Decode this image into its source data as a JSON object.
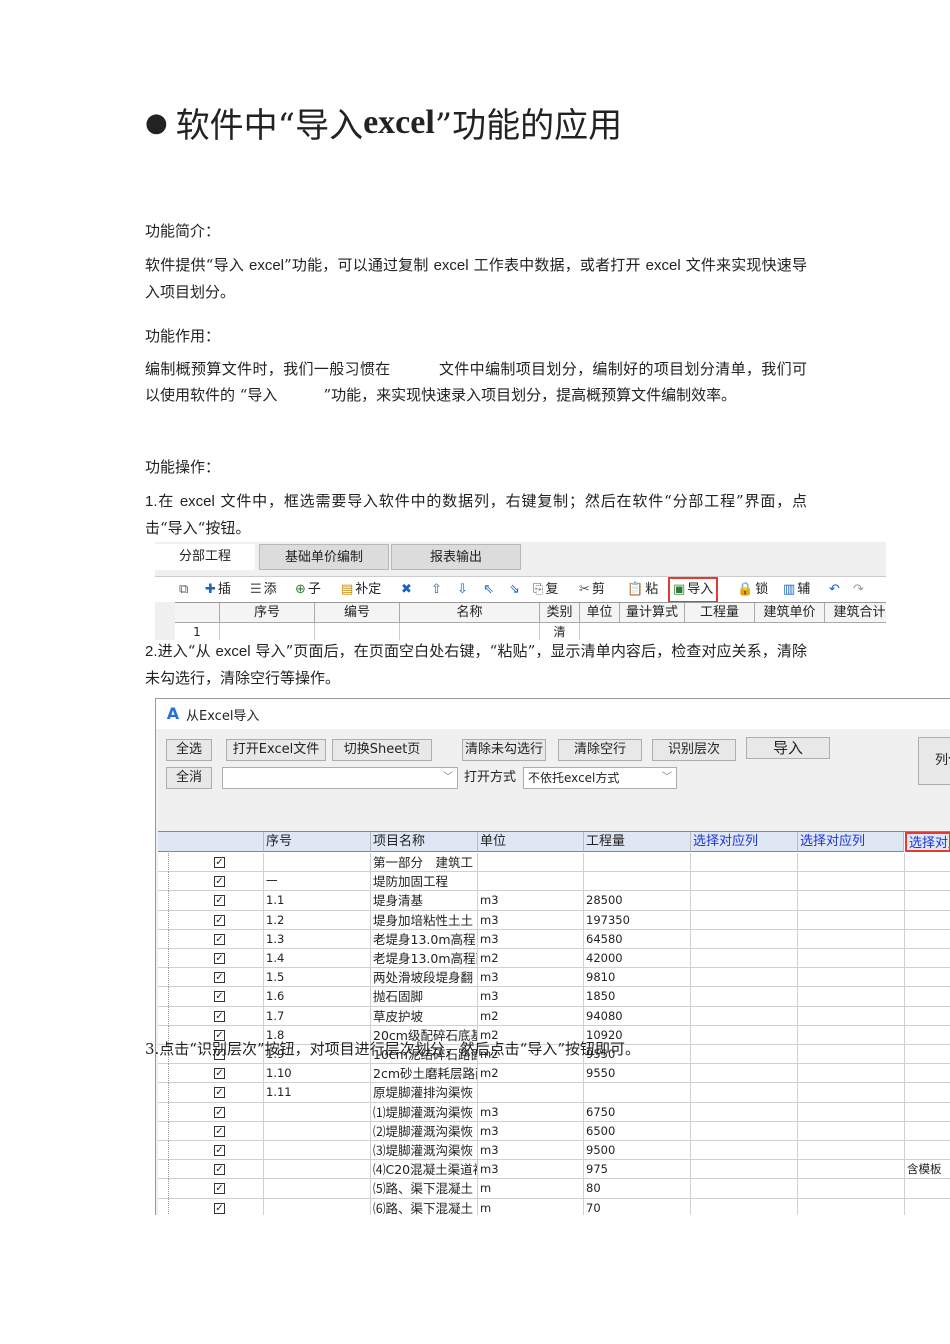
{
  "heading": {
    "bullet": "●",
    "pre": "软件中“导入 ",
    "en": "excel",
    "post": "”功能的应用"
  },
  "sections": {
    "intro_label": "功能简介：",
    "intro_a": "软件提供“导入 ",
    "intro_b": "excel",
    "intro_c": "”功能，可以通过复制 ",
    "intro_d": "excel",
    "intro_e": " 工作表中数据，或者打开 ",
    "intro_f": "excel",
    "intro_g": " 文件来实现快速导入项目划分。",
    "role_label": "功能作用：",
    "role_a": "编制概预算文件时，我们一般习惯在",
    "role_b": "文件中编制项目划分，编制好的项目划分清单，我们可以使用软件的 “导入",
    "role_c": "”功能，来实现快速录入项目划分，提高概预算文件编制效率。",
    "ops_label": "功能操作：",
    "step1_a": "1.",
    "step1_b": "在 ",
    "step1_c": "excel",
    "step1_d": " 文件中，框选需要导入软件中的数据列，右键复制；然后在软件“分部工程”界面，点击“导入“按钮。",
    "step2_a": "2.",
    "step2_b": "进入“从 ",
    "step2_c": "excel",
    "step2_d": " 导入”页面后，在页面空白处右键，“粘贴”，显示清单内容后，检查对应关系，清除未勾选行，清除空行等操作。",
    "step3": "3.点击“识别层次”按钮，对项目进行层次划分，然后点击“导入”按钮即可。"
  },
  "shot1": {
    "tabs": [
      "分部工程",
      "基础单价编制",
      "报表输出"
    ],
    "toolbar": [
      {
        "icon": "⧉",
        "label": ""
      },
      {
        "icon": "✚",
        "label": "插"
      },
      {
        "icon": "☰",
        "label": "添"
      },
      {
        "icon": "⊕",
        "label": "子"
      },
      {
        "icon": "▤",
        "label": "补定"
      },
      {
        "icon": "✖",
        "label": ""
      },
      {
        "icon": "⇧",
        "label": ""
      },
      {
        "icon": "⇩",
        "label": ""
      },
      {
        "icon": "⇖",
        "label": ""
      },
      {
        "icon": "⇘",
        "label": ""
      },
      {
        "icon": "⎘",
        "label": "复"
      },
      {
        "icon": "✂",
        "label": "剪"
      },
      {
        "icon": "📋",
        "label": "粘"
      },
      {
        "icon": "▣",
        "label": "导入"
      },
      {
        "icon": "🔒",
        "label": "锁"
      },
      {
        "icon": "▥",
        "label": "辅"
      },
      {
        "icon": "↶",
        "label": ""
      },
      {
        "icon": "↷",
        "label": ""
      }
    ],
    "grid_headers": [
      "序号",
      "编号",
      "名称",
      "类别",
      "单位",
      "量计算式",
      "工程量",
      "建筑单价",
      "建筑合计"
    ],
    "grid_row": [
      "1",
      "",
      "",
      "清",
      "",
      "",
      "",
      "",
      ""
    ]
  },
  "shot2": {
    "title": "从Excel导入",
    "buttons_row1": [
      "全选",
      "打开Excel文件",
      "切换Sheet页",
      "清除未勾选行",
      "清除空行",
      "识别层次",
      "导入"
    ],
    "btn_deselect": "全消",
    "open_mode_label": "打开方式",
    "open_mode_value": "不依托excel方式",
    "side_btn": "列位",
    "headers": [
      "",
      "序号",
      "项目名称",
      "单位",
      "工程量",
      "选择对应列",
      "选择对应列",
      "选择对应"
    ],
    "rows": [
      {
        "no": "",
        "name": "第一部分　建筑工",
        "unit": "",
        "qty": "",
        "extra": ""
      },
      {
        "no": "一",
        "name": "堤防加固工程",
        "unit": "",
        "qty": "",
        "extra": ""
      },
      {
        "no": "1.1",
        "name": "堤身清基",
        "unit": "m3",
        "qty": "28500",
        "extra": ""
      },
      {
        "no": "1.2",
        "name": "堤身加培粘性土土",
        "unit": "m3",
        "qty": "197350",
        "extra": ""
      },
      {
        "no": "1.3",
        "name": "老堤身13.0m高程以",
        "unit": "m3",
        "qty": "64580",
        "extra": ""
      },
      {
        "no": "1.4",
        "name": "老堤身13.0m高程面",
        "unit": "m2",
        "qty": "42000",
        "extra": ""
      },
      {
        "no": "1.5",
        "name": "两处滑坡段堤身翻",
        "unit": "m3",
        "qty": "9810",
        "extra": ""
      },
      {
        "no": "1.6",
        "name": "抛石固脚",
        "unit": "m3",
        "qty": "1850",
        "extra": ""
      },
      {
        "no": "1.7",
        "name": "草皮护坡",
        "unit": "m2",
        "qty": "94080",
        "extra": ""
      },
      {
        "no": "1.8",
        "name": "20cm级配碎石底基",
        "unit": "m2",
        "qty": "10920",
        "extra": ""
      },
      {
        "no": "1.9",
        "name": "10cm泥结碎石路面",
        "unit": "m2",
        "qty": "9550",
        "extra": ""
      },
      {
        "no": "1.10",
        "name": "2cm砂土磨耗层路面",
        "unit": "m2",
        "qty": "9550",
        "extra": ""
      },
      {
        "no": "1.11",
        "name": "原堤脚灌排沟渠恢",
        "unit": "",
        "qty": "",
        "extra": ""
      },
      {
        "no": "",
        "name": "⑴堤脚灌溉沟渠恢",
        "unit": "m3",
        "qty": "6750",
        "extra": ""
      },
      {
        "no": "",
        "name": "⑵堤脚灌溉沟渠恢",
        "unit": "m3",
        "qty": "6500",
        "extra": ""
      },
      {
        "no": "",
        "name": "⑶堤脚灌溉沟渠恢",
        "unit": "m3",
        "qty": "9500",
        "extra": ""
      },
      {
        "no": "",
        "name": "⑷C20混凝土渠道衬",
        "unit": "m3",
        "qty": "975",
        "extra": "含模板"
      },
      {
        "no": "",
        "name": "⑸路、渠下混凝土",
        "unit": "m",
        "qty": "80",
        "extra": ""
      },
      {
        "no": "",
        "name": "⑹路、渠下混凝土",
        "unit": "m",
        "qty": "70",
        "extra": ""
      }
    ]
  },
  "colors": {
    "highlight": "#e53935",
    "header_blue": "#1a34d6"
  }
}
